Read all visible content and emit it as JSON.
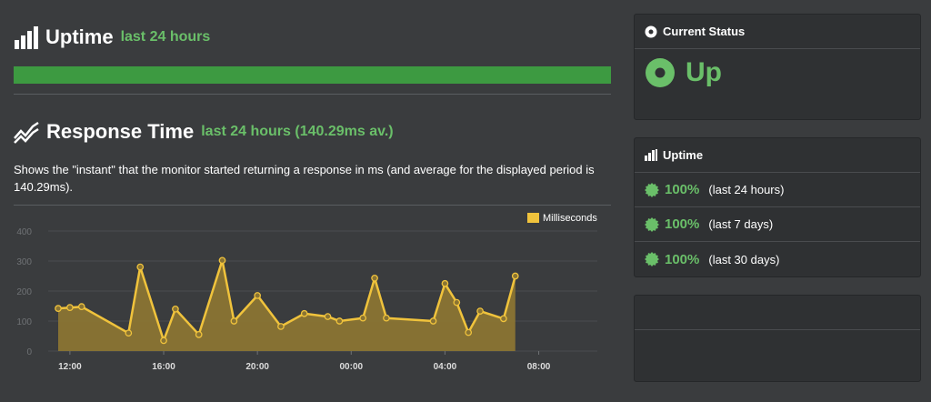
{
  "uptime_section": {
    "title": "Uptime",
    "subtitle": "last 24 hours",
    "bar_color": "#3d9a41"
  },
  "response_section": {
    "title": "Response Time",
    "subtitle": "last 24 hours (140.29ms av.)",
    "description": "Shows the \"instant\" that the monitor started returning a response in ms (and average for the displayed period is 140.29ms)."
  },
  "chart_data": {
    "type": "area",
    "legend": "Milliseconds",
    "legend_placement": "top-right",
    "ylim": [
      0,
      400
    ],
    "y_ticks": [
      "0",
      "100",
      "200",
      "300",
      "400"
    ],
    "x_ticks": [
      {
        "label": "12:00",
        "hour": 12
      },
      {
        "label": "16:00",
        "hour": 16
      },
      {
        "label": "20:00",
        "hour": 20
      },
      {
        "label": "00:00",
        "hour": 24
      },
      {
        "label": "04:00",
        "hour": 28
      },
      {
        "label": "08:00",
        "hour": 32
      }
    ],
    "xlim": [
      11.5,
      34.5
    ],
    "series": [
      {
        "name": "Milliseconds",
        "color": "#f0c33c",
        "points": [
          [
            11.5,
            142
          ],
          [
            12.0,
            145
          ],
          [
            12.5,
            148
          ],
          [
            14.5,
            60
          ],
          [
            15.0,
            280
          ],
          [
            16.0,
            35
          ],
          [
            16.5,
            140
          ],
          [
            17.5,
            55
          ],
          [
            18.5,
            302
          ],
          [
            19.0,
            100
          ],
          [
            20.0,
            185
          ],
          [
            21.0,
            82
          ],
          [
            22.0,
            125
          ],
          [
            23.0,
            115
          ],
          [
            23.5,
            100
          ],
          [
            24.5,
            110
          ],
          [
            25.0,
            243
          ],
          [
            25.5,
            110
          ],
          [
            27.5,
            100
          ],
          [
            28.0,
            225
          ],
          [
            28.5,
            162
          ],
          [
            29.0,
            62
          ],
          [
            29.5,
            133
          ],
          [
            30.5,
            108
          ],
          [
            31.0,
            250
          ]
        ]
      }
    ],
    "grid": true
  },
  "sidebar": {
    "status_panel": {
      "title": "Current Status",
      "value": "Up",
      "icon": "status-dot-icon"
    },
    "uptime_panel": {
      "title": "Uptime",
      "rows": [
        {
          "value": "100%",
          "period": "(last 24 hours)"
        },
        {
          "value": "100%",
          "period": "(last 7 days)"
        },
        {
          "value": "100%",
          "period": "(last 30 days)"
        }
      ]
    }
  }
}
